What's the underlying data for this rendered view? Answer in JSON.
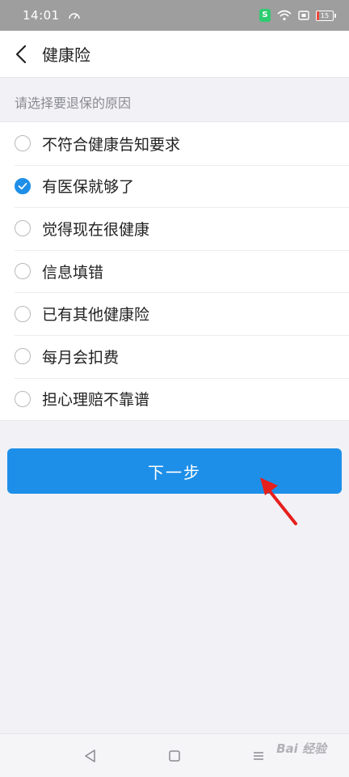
{
  "status_bar": {
    "time": "14:01",
    "battery": "15"
  },
  "header": {
    "title": "健康险"
  },
  "prompt": "请选择要退保的原因",
  "options": [
    {
      "label": "不符合健康告知要求",
      "checked": false
    },
    {
      "label": "有医保就够了",
      "checked": true
    },
    {
      "label": "觉得现在很健康",
      "checked": false
    },
    {
      "label": "信息填错",
      "checked": false
    },
    {
      "label": "已有其他健康险",
      "checked": false
    },
    {
      "label": "每月会扣费",
      "checked": false
    },
    {
      "label": "担心理赔不靠谱",
      "checked": false
    }
  ],
  "next_button": "下一步",
  "watermark": "Bai 经验",
  "colors": {
    "accent": "#1e8fe8",
    "arrow": "#e6201c",
    "status_bar": "#9e9e9e"
  },
  "icons": [
    "back-chevron-icon",
    "check-icon",
    "wifi-icon",
    "shield-icon",
    "battery-icon",
    "nav-back-icon",
    "nav-home-icon",
    "nav-menu-icon",
    "annotation-arrow-icon"
  ]
}
